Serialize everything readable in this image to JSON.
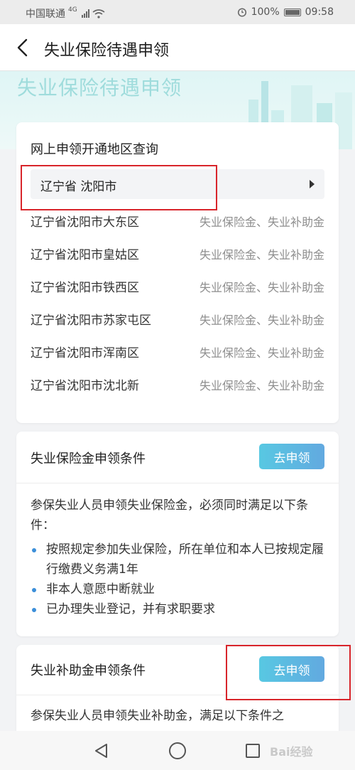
{
  "status_bar": {
    "carrier": "中国联通",
    "network": "4G",
    "alarm_icon": "alarm-clock-icon",
    "battery": "100%",
    "time": "09:58"
  },
  "header": {
    "title": "失业保险待遇申领"
  },
  "hero": {
    "title": "失业保险待遇申领"
  },
  "region_card": {
    "title": "网上申领开通地区查询",
    "selected_region": "辽宁省 沈阳市",
    "rows": [
      {
        "name": "辽宁省沈阳市大东区",
        "services": "失业保险金、失业补助金"
      },
      {
        "name": "辽宁省沈阳市皇姑区",
        "services": "失业保险金、失业补助金"
      },
      {
        "name": "辽宁省沈阳市铁西区",
        "services": "失业保险金、失业补助金"
      },
      {
        "name": "辽宁省沈阳市苏家屯区",
        "services": "失业保险金、失业补助金"
      },
      {
        "name": "辽宁省沈阳市浑南区",
        "services": "失业保险金、失业补助金"
      },
      {
        "name": "辽宁省沈阳市沈北新",
        "services": "失业保险金、失业补助金"
      }
    ]
  },
  "insurance_card": {
    "title": "失业保险金申领条件",
    "button": "去申领",
    "intro": "参保失业人员申领失业保险金，必须同时满足以下条件：",
    "conditions": [
      "按照规定参加失业保险，所在单位和本人已按规定履行缴费义务满1年",
      "非本人意愿中断就业",
      "已办理失业登记，并有求职要求"
    ]
  },
  "subsidy_card": {
    "title": "失业补助金申领条件",
    "button": "去申领",
    "intro": "参保失业人员申领失业补助金，满足以下条件之"
  },
  "watermark": "Bai经验",
  "colors": {
    "accent": "#5bbde2",
    "highlight": "#d8252b",
    "bullet": "#3c8fd9",
    "hero_title": "#9fdcdc"
  }
}
